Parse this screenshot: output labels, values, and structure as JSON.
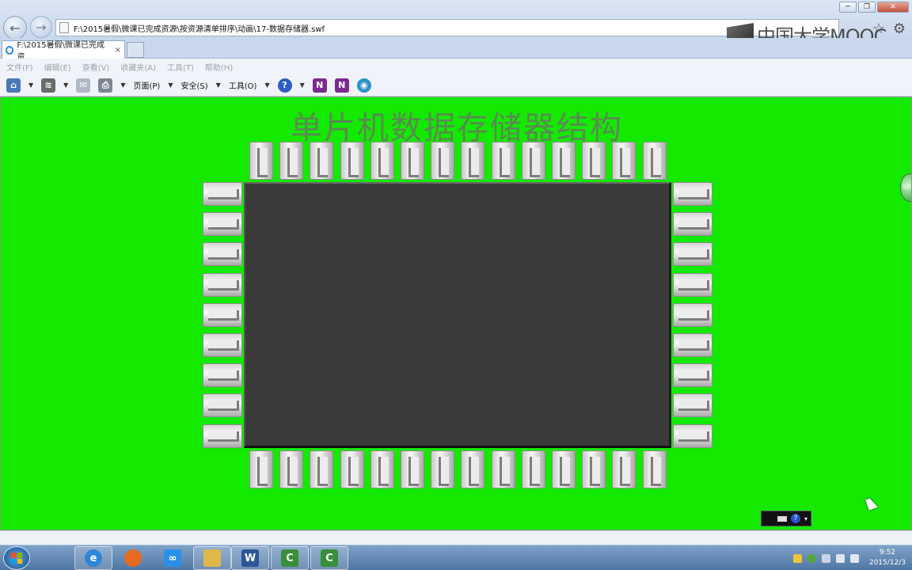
{
  "browser": {
    "address": "F:\\2015暑假\\微课已完成资源\\按资源清单排序\\动画\\17-数据存储器.swf",
    "tab_title": "F:\\2015暑假\\微课已完成资...",
    "tab_close": "×",
    "back": "←",
    "forward": "→",
    "window_minimize": "─",
    "window_restore": "❐",
    "window_close": "✕",
    "brand": "中国大学MOOC"
  },
  "menu": {
    "file": "文件(F)",
    "edit": "编辑(E)",
    "view": "查看(V)",
    "favorites": "收藏夹(A)",
    "tools": "工具(T)",
    "help": "帮助(H)"
  },
  "commandbar": {
    "page": "页面(P)",
    "safety": "安全(S)",
    "tools": "工具(O)"
  },
  "content": {
    "heading": "单片机数据存储器结构",
    "side_bubble": "50"
  },
  "taskbar": {
    "time": "9:52",
    "date": "2015/12/3",
    "word": "W",
    "app1": "C",
    "app2": "C"
  },
  "colors": {
    "content_bg": "#13ea00",
    "chip_body": "#3a3a3a",
    "heading": "#5b8a53"
  }
}
